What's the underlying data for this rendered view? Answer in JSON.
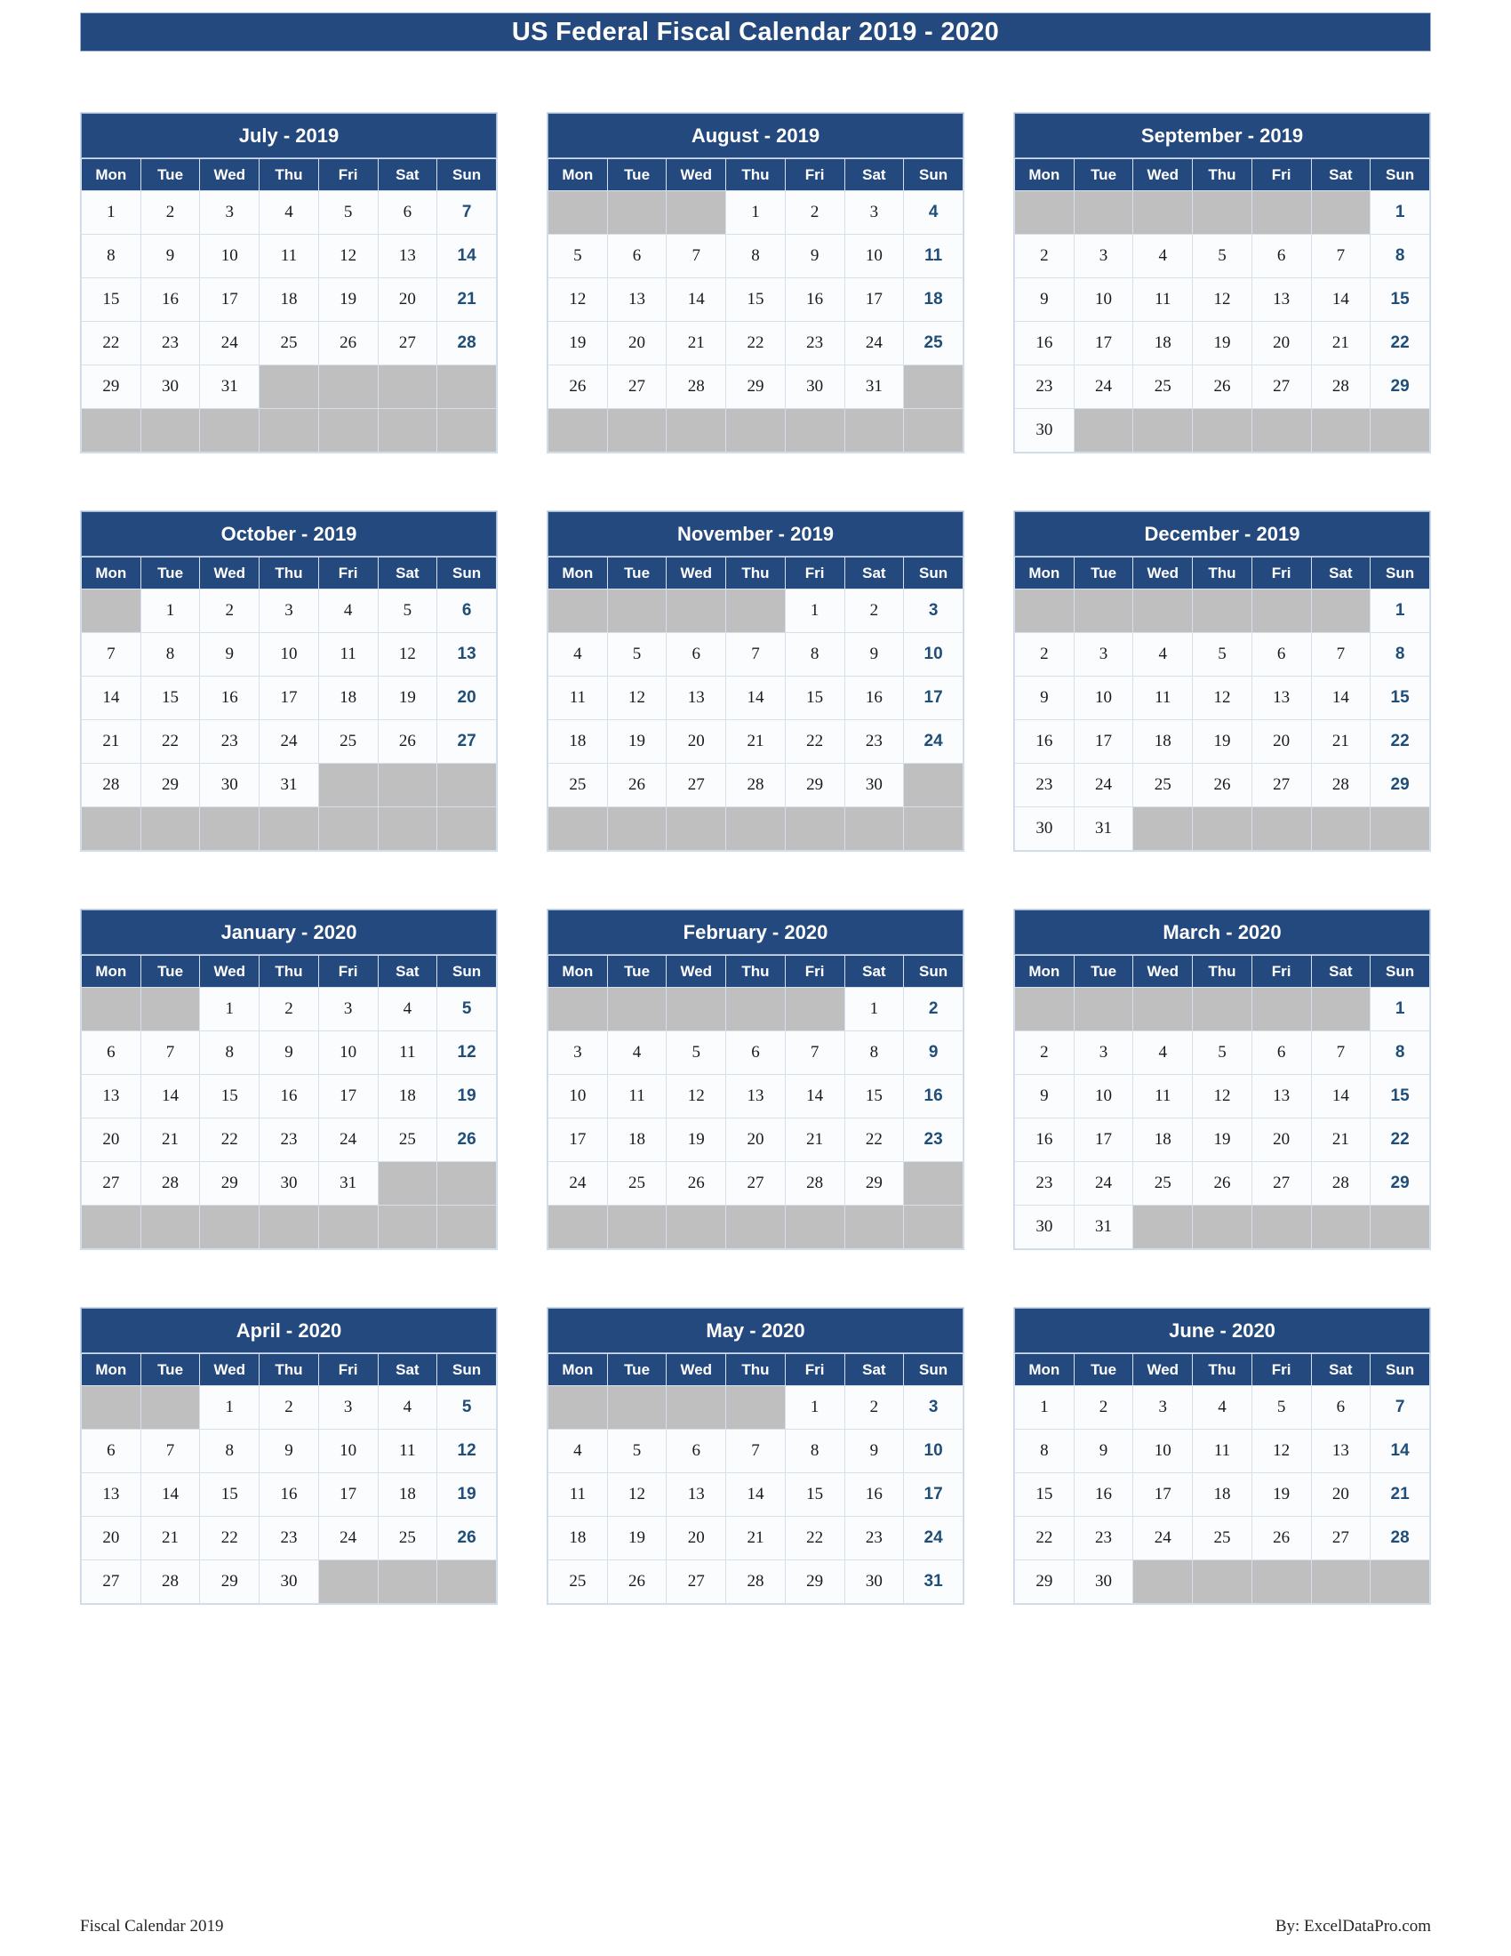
{
  "document": {
    "title": "US Federal Fiscal Calendar 2019 - 2020",
    "footer_left": "Fiscal Calendar 2019",
    "footer_right": "By: ExcelDataPro.com"
  },
  "colors": {
    "header_blue": "#24497E",
    "sunday_text": "#1F4E79",
    "blank_cell": "#bfbfbf",
    "cell_background": "#fbfcfd",
    "grid_line": "#d5e0ec"
  },
  "weekday_headers": [
    "Mon",
    "Tue",
    "Wed",
    "Thu",
    "Fri",
    "Sat",
    "Sun"
  ],
  "months": [
    {
      "title": "July - 2019",
      "name": "July",
      "year": "2019",
      "weeks": [
        [
          "1",
          "2",
          "3",
          "4",
          "5",
          "6",
          "7"
        ],
        [
          "8",
          "9",
          "10",
          "11",
          "12",
          "13",
          "14"
        ],
        [
          "15",
          "16",
          "17",
          "18",
          "19",
          "20",
          "21"
        ],
        [
          "22",
          "23",
          "24",
          "25",
          "26",
          "27",
          "28"
        ],
        [
          "29",
          "30",
          "31",
          "",
          "",
          "",
          ""
        ],
        [
          "",
          "",
          "",
          "",
          "",
          "",
          ""
        ]
      ]
    },
    {
      "title": "August - 2019",
      "name": "August",
      "year": "2019",
      "weeks": [
        [
          "",
          "",
          "",
          "1",
          "2",
          "3",
          "4"
        ],
        [
          "5",
          "6",
          "7",
          "8",
          "9",
          "10",
          "11"
        ],
        [
          "12",
          "13",
          "14",
          "15",
          "16",
          "17",
          "18"
        ],
        [
          "19",
          "20",
          "21",
          "22",
          "23",
          "24",
          "25"
        ],
        [
          "26",
          "27",
          "28",
          "29",
          "30",
          "31",
          ""
        ],
        [
          "",
          "",
          "",
          "",
          "",
          "",
          ""
        ]
      ]
    },
    {
      "title": "September - 2019",
      "name": "September",
      "year": "2019",
      "weeks": [
        [
          "",
          "",
          "",
          "",
          "",
          "",
          "1"
        ],
        [
          "2",
          "3",
          "4",
          "5",
          "6",
          "7",
          "8"
        ],
        [
          "9",
          "10",
          "11",
          "12",
          "13",
          "14",
          "15"
        ],
        [
          "16",
          "17",
          "18",
          "19",
          "20",
          "21",
          "22"
        ],
        [
          "23",
          "24",
          "25",
          "26",
          "27",
          "28",
          "29"
        ],
        [
          "30",
          "",
          "",
          "",
          "",
          "",
          ""
        ]
      ]
    },
    {
      "title": "October - 2019",
      "name": "October",
      "year": "2019",
      "weeks": [
        [
          "",
          "1",
          "2",
          "3",
          "4",
          "5",
          "6"
        ],
        [
          "7",
          "8",
          "9",
          "10",
          "11",
          "12",
          "13"
        ],
        [
          "14",
          "15",
          "16",
          "17",
          "18",
          "19",
          "20"
        ],
        [
          "21",
          "22",
          "23",
          "24",
          "25",
          "26",
          "27"
        ],
        [
          "28",
          "29",
          "30",
          "31",
          "",
          "",
          ""
        ],
        [
          "",
          "",
          "",
          "",
          "",
          "",
          ""
        ]
      ]
    },
    {
      "title": "November - 2019",
      "name": "November",
      "year": "2019",
      "weeks": [
        [
          "",
          "",
          "",
          "",
          "1",
          "2",
          "3"
        ],
        [
          "4",
          "5",
          "6",
          "7",
          "8",
          "9",
          "10"
        ],
        [
          "11",
          "12",
          "13",
          "14",
          "15",
          "16",
          "17"
        ],
        [
          "18",
          "19",
          "20",
          "21",
          "22",
          "23",
          "24"
        ],
        [
          "25",
          "26",
          "27",
          "28",
          "29",
          "30",
          ""
        ],
        [
          "",
          "",
          "",
          "",
          "",
          "",
          ""
        ]
      ]
    },
    {
      "title": "December - 2019",
      "name": "December",
      "year": "2019",
      "weeks": [
        [
          "",
          "",
          "",
          "",
          "",
          "",
          "1"
        ],
        [
          "2",
          "3",
          "4",
          "5",
          "6",
          "7",
          "8"
        ],
        [
          "9",
          "10",
          "11",
          "12",
          "13",
          "14",
          "15"
        ],
        [
          "16",
          "17",
          "18",
          "19",
          "20",
          "21",
          "22"
        ],
        [
          "23",
          "24",
          "25",
          "26",
          "27",
          "28",
          "29"
        ],
        [
          "30",
          "31",
          "",
          "",
          "",
          "",
          ""
        ]
      ]
    },
    {
      "title": "January - 2020",
      "name": "January",
      "year": "2020",
      "weeks": [
        [
          "",
          "",
          "1",
          "2",
          "3",
          "4",
          "5"
        ],
        [
          "6",
          "7",
          "8",
          "9",
          "10",
          "11",
          "12"
        ],
        [
          "13",
          "14",
          "15",
          "16",
          "17",
          "18",
          "19"
        ],
        [
          "20",
          "21",
          "22",
          "23",
          "24",
          "25",
          "26"
        ],
        [
          "27",
          "28",
          "29",
          "30",
          "31",
          "",
          ""
        ],
        [
          "",
          "",
          "",
          "",
          "",
          "",
          ""
        ]
      ]
    },
    {
      "title": "February - 2020",
      "name": "February",
      "year": "2020",
      "weeks": [
        [
          "",
          "",
          "",
          "",
          "",
          "1",
          "2"
        ],
        [
          "3",
          "4",
          "5",
          "6",
          "7",
          "8",
          "9"
        ],
        [
          "10",
          "11",
          "12",
          "13",
          "14",
          "15",
          "16"
        ],
        [
          "17",
          "18",
          "19",
          "20",
          "21",
          "22",
          "23"
        ],
        [
          "24",
          "25",
          "26",
          "27",
          "28",
          "29",
          ""
        ],
        [
          "",
          "",
          "",
          "",
          "",
          "",
          ""
        ]
      ]
    },
    {
      "title": "March - 2020",
      "name": "March",
      "year": "2020",
      "weeks": [
        [
          "",
          "",
          "",
          "",
          "",
          "",
          "1"
        ],
        [
          "2",
          "3",
          "4",
          "5",
          "6",
          "7",
          "8"
        ],
        [
          "9",
          "10",
          "11",
          "12",
          "13",
          "14",
          "15"
        ],
        [
          "16",
          "17",
          "18",
          "19",
          "20",
          "21",
          "22"
        ],
        [
          "23",
          "24",
          "25",
          "26",
          "27",
          "28",
          "29"
        ],
        [
          "30",
          "31",
          "",
          "",
          "",
          "",
          ""
        ]
      ]
    },
    {
      "title": "April - 2020",
      "name": "April",
      "year": "2020",
      "weeks": [
        [
          "",
          "",
          "1",
          "2",
          "3",
          "4",
          "5"
        ],
        [
          "6",
          "7",
          "8",
          "9",
          "10",
          "11",
          "12"
        ],
        [
          "13",
          "14",
          "15",
          "16",
          "17",
          "18",
          "19"
        ],
        [
          "20",
          "21",
          "22",
          "23",
          "24",
          "25",
          "26"
        ],
        [
          "27",
          "28",
          "29",
          "30",
          "",
          "",
          ""
        ]
      ]
    },
    {
      "title": "May - 2020",
      "name": "May",
      "year": "2020",
      "weeks": [
        [
          "",
          "",
          "",
          "",
          "1",
          "2",
          "3"
        ],
        [
          "4",
          "5",
          "6",
          "7",
          "8",
          "9",
          "10"
        ],
        [
          "11",
          "12",
          "13",
          "14",
          "15",
          "16",
          "17"
        ],
        [
          "18",
          "19",
          "20",
          "21",
          "22",
          "23",
          "24"
        ],
        [
          "25",
          "26",
          "27",
          "28",
          "29",
          "30",
          "31"
        ]
      ]
    },
    {
      "title": "June - 2020",
      "name": "June",
      "year": "2020",
      "weeks": [
        [
          "1",
          "2",
          "3",
          "4",
          "5",
          "6",
          "7"
        ],
        [
          "8",
          "9",
          "10",
          "11",
          "12",
          "13",
          "14"
        ],
        [
          "15",
          "16",
          "17",
          "18",
          "19",
          "20",
          "21"
        ],
        [
          "22",
          "23",
          "24",
          "25",
          "26",
          "27",
          "28"
        ],
        [
          "29",
          "30",
          "",
          "",
          "",
          "",
          ""
        ]
      ]
    }
  ]
}
